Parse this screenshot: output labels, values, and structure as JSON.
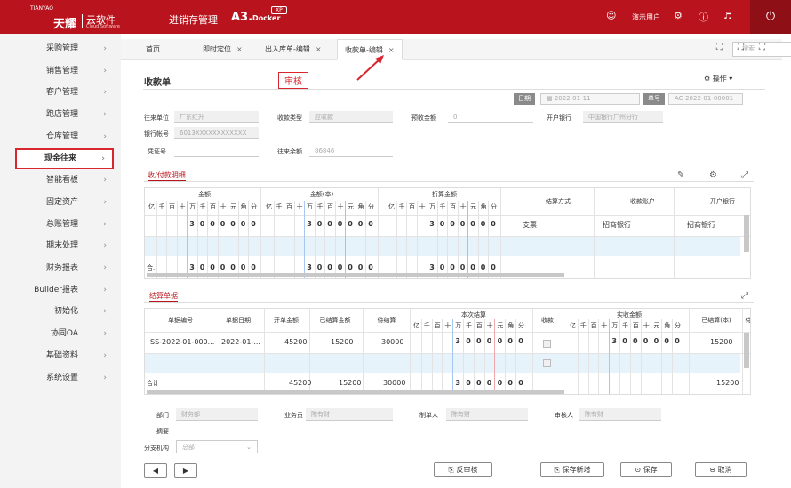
{
  "topbar": {
    "logo_small": "TIANYAO",
    "logo_big": "天耀",
    "logo_soft": "云软件",
    "logo_soft_en": "Cloud Software",
    "product": "进销存管理",
    "edition": "A3.",
    "edition_sub": "Docker",
    "badge": "XP",
    "user": "演示用户",
    "icons": [
      "user-icon",
      "gear-icon",
      "help-icon",
      "speaker-icon",
      "power-icon"
    ]
  },
  "sidebar": {
    "items": [
      {
        "label": "采购管理"
      },
      {
        "label": "销售管理"
      },
      {
        "label": "客户管理"
      },
      {
        "label": "跑店管理"
      },
      {
        "label": "仓库管理"
      },
      {
        "label": "现金往来",
        "active": true
      },
      {
        "label": "智能看板"
      },
      {
        "label": "固定资产"
      },
      {
        "label": "总账管理"
      },
      {
        "label": "期末处理"
      },
      {
        "label": "财务报表"
      },
      {
        "label": "Builder报表"
      },
      {
        "label": "初始化"
      },
      {
        "label": "协同OA"
      },
      {
        "label": "基础资料"
      },
      {
        "label": "系统设置"
      }
    ]
  },
  "tabs": {
    "items": [
      {
        "label": "首页",
        "closable": false
      },
      {
        "label": "即时定位",
        "closable": true
      },
      {
        "label": "出入库单-编辑",
        "closable": true
      },
      {
        "label": "收款单-编辑",
        "closable": true,
        "active": true
      }
    ],
    "search_placeholder": "搜索"
  },
  "form": {
    "title": "收款单",
    "audit_label": "审核",
    "ops_label": "操作",
    "date_tag": "日期",
    "date_value": "2022-01-11",
    "no_tag": "单号",
    "no_value": "AC-2022-01-00001",
    "fields": {
      "unit_label": "往来单位",
      "unit_value": "广东红升",
      "type_label": "收款类型",
      "type_value": "应收款",
      "prepay_label": "预收金额",
      "prepay_value": "0",
      "bank_label": "开户银行",
      "bank_value": "中国银行广州分行",
      "account_label": "银行帐号",
      "account_value": "6013XXXXXXXXXXXX",
      "voucher_label": "凭证号",
      "voucher_value": "",
      "balance_label": "往来余额",
      "balance_value": "86846"
    }
  },
  "detail": {
    "title": "收/付款明细",
    "headers": {
      "amount": "金额",
      "amount_base": "金额(本)",
      "discount": "折算金额",
      "method": "结算方式",
      "account": "收款账户",
      "bank": "开户银行"
    },
    "digit_units": [
      "亿",
      "千",
      "百",
      "十",
      "万",
      "千",
      "百",
      "十",
      "元",
      "角",
      "分"
    ],
    "row": {
      "digits": [
        "3",
        "0",
        "0",
        "0",
        "0",
        "0",
        "0"
      ],
      "method": "支票",
      "account": "招商银行",
      "bank": "招商银行"
    },
    "total_label": "合..",
    "total_digits": [
      "3",
      "0",
      "0",
      "0",
      "0",
      "0",
      "0"
    ]
  },
  "settle": {
    "title": "结算单据",
    "headers": {
      "no": "单据编号",
      "date": "单据日期",
      "open": "开单金额",
      "settled": "已结算金额",
      "pending": "待结算",
      "current": "本次结算",
      "receive": "收款",
      "actual": "实收金额",
      "settled_base": "已结算(本)",
      "pending_base": "待"
    },
    "row": {
      "no": "SS-2022-01-000...",
      "date": "2022-01-...",
      "open": "45200",
      "settled": "15200",
      "pending": "30000",
      "digits": [
        "3",
        "0",
        "0",
        "0",
        "0",
        "0",
        "0"
      ],
      "actual_digits": [
        "3",
        "0",
        "0",
        "0",
        "0",
        "0",
        "0"
      ],
      "settled_base": "15200"
    },
    "total": {
      "label": "合计",
      "open": "45200",
      "settled": "15200",
      "pending": "30000",
      "digits": [
        "3",
        "0",
        "0",
        "0",
        "0",
        "0",
        "0"
      ],
      "settled_base": "15200"
    }
  },
  "footer": {
    "dept_label": "部门",
    "dept_value": "财务部",
    "staff_label": "业务员",
    "staff_value": "陈有财",
    "maker_label": "制单人",
    "maker_value": "陈有财",
    "auditor_label": "审核人",
    "auditor_value": "陈有财",
    "summary_label": "摘要",
    "branch_label": "分支机构",
    "branch_value": "总部"
  },
  "buttons": {
    "unaudit": "反审核",
    "save_new": "保存新增",
    "save": "保存",
    "cancel": "取消"
  }
}
